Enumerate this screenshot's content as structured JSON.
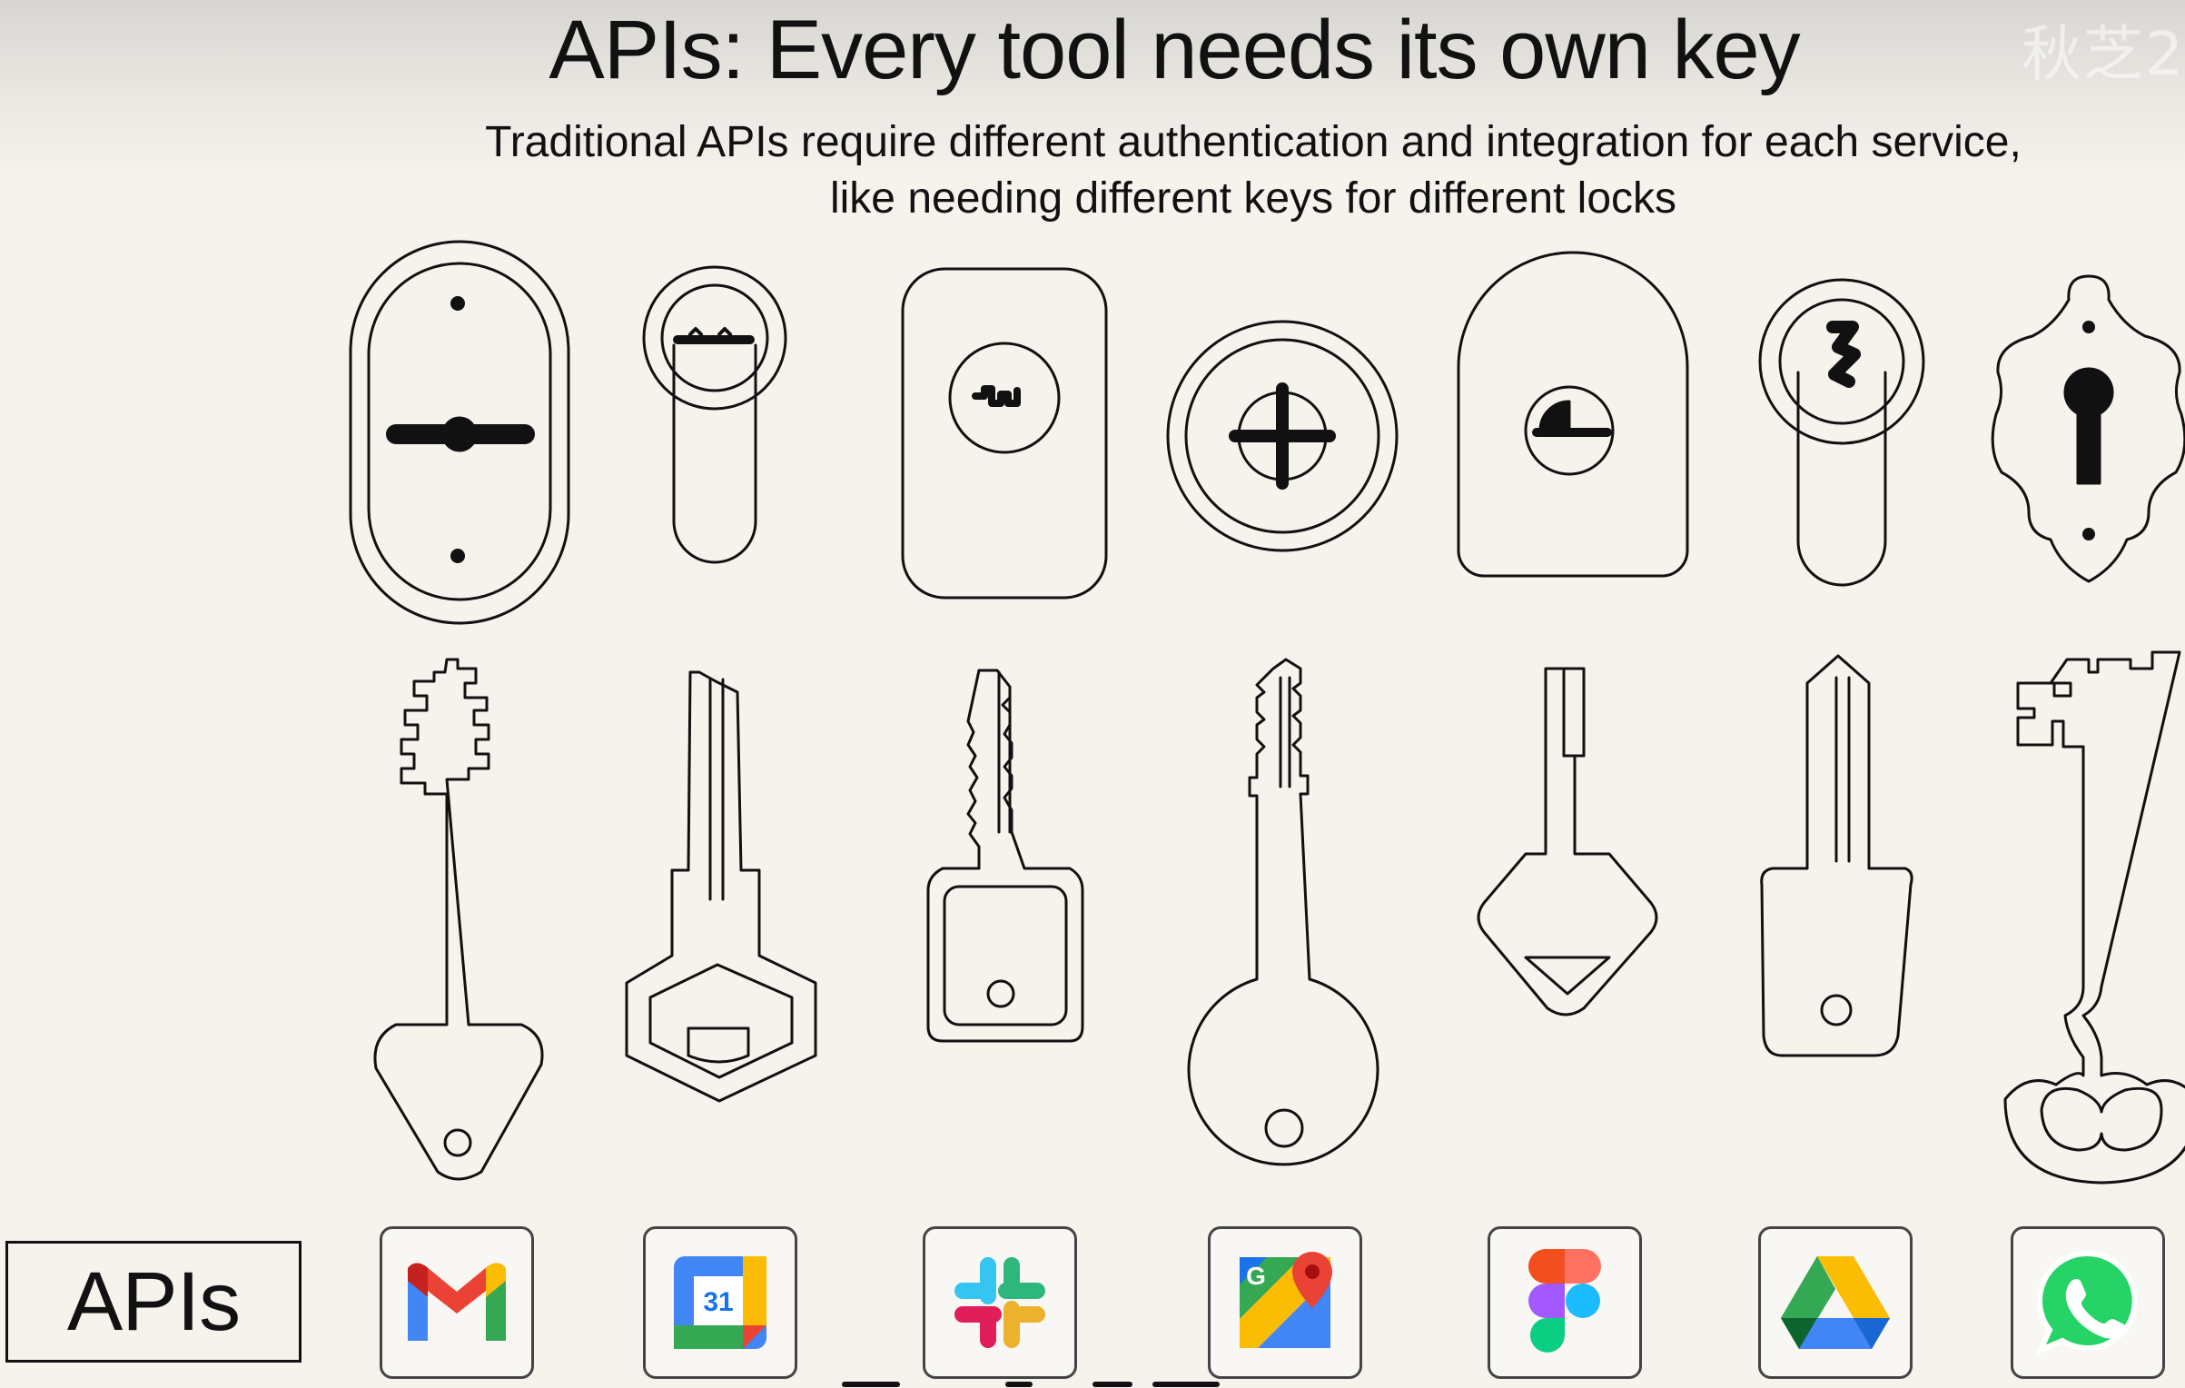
{
  "slide": {
    "title": "APIs: Every tool needs its own key",
    "subtitle_line1": "Traditional APIs require different authentication and integration for each service,",
    "subtitle_line2": "like needing different keys for different locks",
    "watermark": "秋芝2"
  },
  "label_box": {
    "text": "APIs"
  },
  "locks": [
    {
      "name": "oval-keyhole-lock-icon"
    },
    {
      "name": "euro-cylinder-lock-icon"
    },
    {
      "name": "rounded-rect-lock-icon"
    },
    {
      "name": "round-cross-lock-icon"
    },
    {
      "name": "arch-lock-icon"
    },
    {
      "name": "cylinder-zigzag-lock-icon"
    },
    {
      "name": "ornate-keyhole-lock-icon"
    }
  ],
  "keys": [
    {
      "name": "pin-tumbler-triangle-key-icon"
    },
    {
      "name": "hexagon-bow-key-icon"
    },
    {
      "name": "square-bow-key-icon"
    },
    {
      "name": "round-bow-key-icon"
    },
    {
      "name": "diamond-bow-key-icon"
    },
    {
      "name": "trapezoid-bow-key-icon"
    },
    {
      "name": "skeleton-key-icon"
    }
  ],
  "apps": [
    {
      "name": "gmail-icon",
      "label": ""
    },
    {
      "name": "google-calendar-icon",
      "label": "31"
    },
    {
      "name": "slack-icon",
      "label": ""
    },
    {
      "name": "google-maps-icon",
      "label": "G"
    },
    {
      "name": "figma-icon",
      "label": ""
    },
    {
      "name": "google-drive-icon",
      "label": ""
    },
    {
      "name": "whatsapp-icon",
      "label": ""
    }
  ],
  "colors": {
    "background": "#f6f2ec",
    "line": "#111111",
    "gmail_red": "#ea4335",
    "google_blue": "#4285f4",
    "google_green": "#34a853",
    "google_yellow": "#fbbc04",
    "slack_purple": "#4a154b",
    "whatsapp_green": "#25d366",
    "figma_orange": "#f24e1e",
    "figma_purple": "#a259ff"
  }
}
